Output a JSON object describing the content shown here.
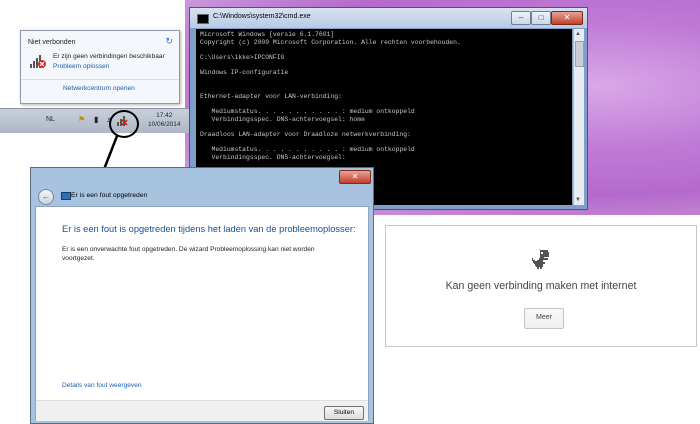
{
  "network_flyout": {
    "status": "Niet verbonden",
    "message": "Er zijn geen verbindingen beschikbaar",
    "troubleshoot_link": "Probleem oplossen",
    "network_center_link": "Netwerkcentrum openen"
  },
  "taskbar": {
    "language": "NL",
    "time": "17:42",
    "date": "10/06/2014"
  },
  "cmd": {
    "title": "C:\\Windows\\system32\\cmd.exe",
    "lines": [
      "Microsoft Windows [versie 6.1.7601]",
      "Copyright (c) 2009 Microsoft Corporation. Alle rechten voorbehouden.",
      "",
      "C:\\Users\\ikke>IPCONFIG",
      "",
      "Windows IP-configuratie",
      "",
      "",
      "Ethernet-adapter voor LAN-verbinding:",
      "",
      "   Mediumstatus. . . . . . . . . . . : medium ontkoppeld",
      "   Verbindingsspec. DNS-achtervoegsel: home",
      "",
      "Draadloos LAN-adapter voor Draadloze netwerkverbinding:",
      "",
      "   Mediumstatus. . . . . . . . . . . : medium ontkoppeld",
      "   Verbindingsspec. DNS-achtervoegsel:",
      "",
      "C:\\Users\\ikke>"
    ]
  },
  "dialog": {
    "nav_title": "Er is een fout opgetreden",
    "heading": "Er is een fout is opgetreden tijdens het laden van de probleemoplosser:",
    "body": "Er is een onverwachte fout opgetreden. De wizard Probleemoplossing kan niet worden voortgezet.",
    "details_link": "Details van fout weergeven",
    "close_button": "Sluiten"
  },
  "chrome_offline": {
    "message": "Kan geen verbinding maken met internet",
    "more_button": "Meer"
  }
}
